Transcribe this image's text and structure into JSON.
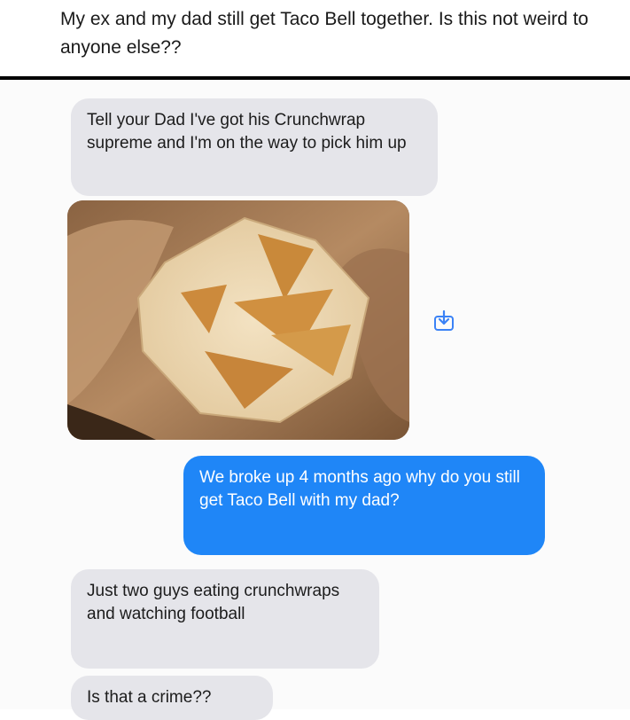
{
  "post": {
    "caption": "My ex and my dad still get Taco Bell together. Is this not weird to anyone else??"
  },
  "messages": [
    {
      "direction": "incoming",
      "text": "Tell your Dad I've got his Crunchwrap supreme and I'm on the way to pick him up"
    },
    {
      "direction": "incoming",
      "type": "image"
    },
    {
      "direction": "outgoing",
      "text": "We broke up 4 months ago why do you still get Taco Bell with my dad?"
    },
    {
      "direction": "incoming",
      "text": "Just two guys eating crunchwraps and watching football"
    },
    {
      "direction": "incoming",
      "text": "Is that a crime??"
    }
  ],
  "icons": {
    "save": "save-to-photos-icon"
  },
  "colors": {
    "incoming_bubble": "#e5e5ea",
    "outgoing_bubble": "#1f86f7",
    "accent_icon": "#3b82f6"
  }
}
